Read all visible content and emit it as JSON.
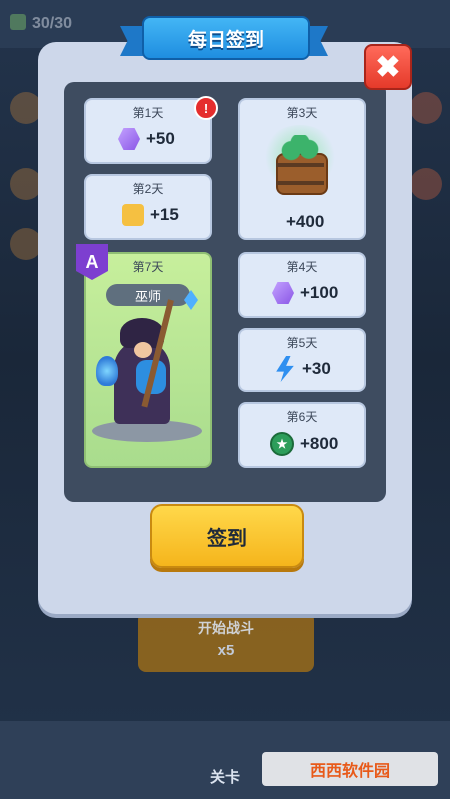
{
  "background": {
    "hp_text": "30/30",
    "mission_text": "开始战斗",
    "mission_multiplier": "x5",
    "bottom_label": "关卡",
    "watermark": "西西软件园"
  },
  "dialog": {
    "title": "每日签到",
    "close_label": "✖",
    "sign_button": "签到",
    "days": [
      {
        "day": "第1天",
        "reward_type": "gem",
        "amount": "+50"
      },
      {
        "day": "第2天",
        "reward_type": "puzzle",
        "amount": "+15"
      },
      {
        "day": "第3天",
        "reward_type": "coin-barrel",
        "amount": "+400"
      },
      {
        "day": "第4天",
        "reward_type": "gem",
        "amount": "+100"
      },
      {
        "day": "第5天",
        "reward_type": "energy",
        "amount": "+30"
      },
      {
        "day": "第6天",
        "reward_type": "coin",
        "amount": "+800"
      },
      {
        "day": "第7天",
        "reward_type": "hero",
        "hero_name": "巫师",
        "rank": "A"
      }
    ],
    "alert_badge": "!"
  },
  "colors": {
    "panel": "#cdd7ea",
    "inner": "#3e4c60",
    "title_blue": "#1f8ee0",
    "close_red": "#e53a2a",
    "button_yellow": "#f5b51c"
  }
}
